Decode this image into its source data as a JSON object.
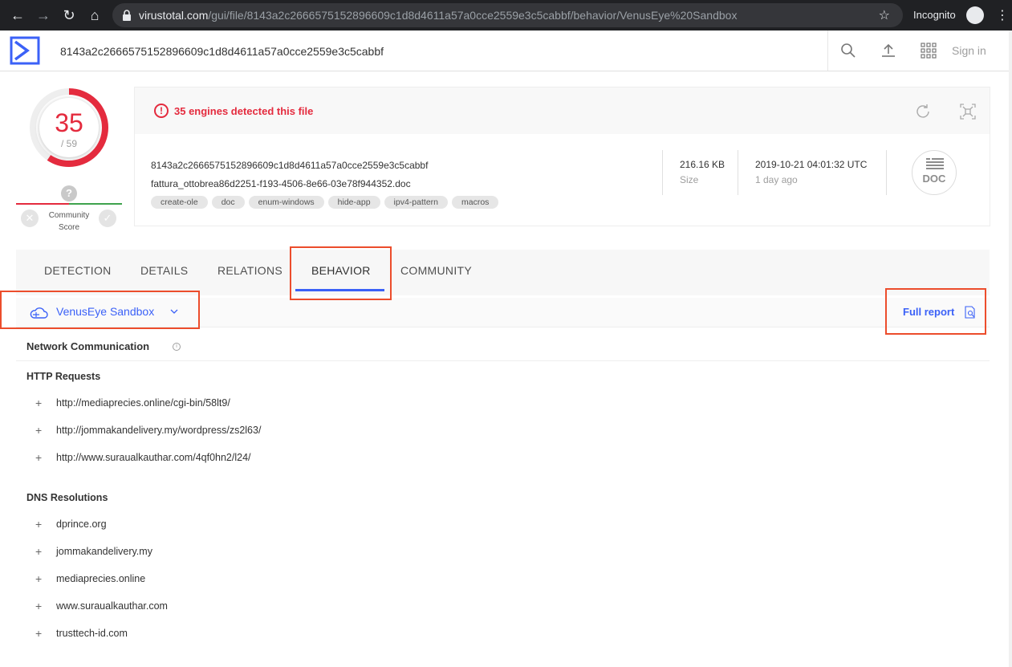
{
  "browser": {
    "url_host": "virustotal.com",
    "url_path": "/gui/file/8143a2c2666575152896609c1d8d4611a57a0cce2559e3c5cabbf/behavior/VenusEye%20Sandbox",
    "incognito_label": "Incognito"
  },
  "header": {
    "search_value": "8143a2c2666575152896609c1d8d4611a57a0cce2559e3c5cabbf",
    "sign_in": "Sign in"
  },
  "score": {
    "detections": "35",
    "total": "/ 59",
    "detection_ratio": 0.593,
    "community_label_1": "Community",
    "community_label_2": "Score",
    "unknown": "?"
  },
  "summary": {
    "alert": "35 engines detected this file",
    "hash": "8143a2c2666575152896609c1d8d4611a57a0cce2559e3c5cabbf",
    "filename": "fattura_ottobrea86d2251-f193-4506-8e66-03e78f944352.doc",
    "tags": [
      "create-ole",
      "doc",
      "enum-windows",
      "hide-app",
      "ipv4-pattern",
      "macros"
    ],
    "size_value": "216.16 KB",
    "size_label": "Size",
    "date_value": "2019-10-21 04:01:32 UTC",
    "date_label": "1 day ago",
    "filetype": "DOC"
  },
  "tabs": [
    "DETECTION",
    "DETAILS",
    "RELATIONS",
    "BEHAVIOR",
    "COMMUNITY"
  ],
  "active_tab": "BEHAVIOR",
  "sandbox": {
    "selected": "VenusEye Sandbox",
    "full_report": "Full report"
  },
  "network": {
    "title": "Network Communication",
    "http_title": "HTTP Requests",
    "http": [
      "http://mediaprecies.online/cgi-bin/58lt9/",
      "http://jommakandelivery.my/wordpress/zs2l63/",
      "http://www.suraualkauthar.com/4qf0hn2/l24/"
    ],
    "dns_title": "DNS Resolutions",
    "dns": [
      "dprince.org",
      "jommakandelivery.my",
      "mediaprecies.online",
      "www.suraualkauthar.com",
      "trusttech-id.com"
    ]
  },
  "colors": {
    "accent": "#3b61f7",
    "malicious": "#e42b3e",
    "highlight": "#ec4d2c"
  }
}
